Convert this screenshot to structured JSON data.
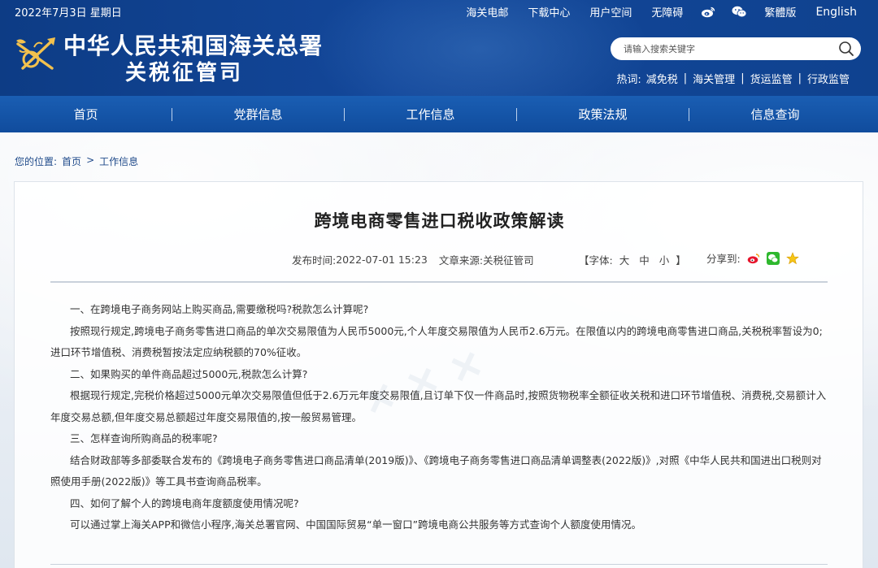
{
  "header": {
    "date": "2022年7月3日 星期日",
    "top_links": [
      "海关电邮",
      "下载中心",
      "用户空间",
      "无障碍"
    ],
    "traditional": "繁體版",
    "english": "English",
    "site_name_line1": "中华人民共和国海关总署",
    "site_name_line2": "关税征管司",
    "search_placeholder": "请输入搜索关键字",
    "hot_label": "热词:",
    "hot_words": [
      "减免税",
      "海关管理",
      "货运监管",
      "行政监管"
    ],
    "icons": [
      "weibo-icon",
      "wechat-icon",
      "search-icon",
      "customs-emblem-logo"
    ]
  },
  "nav": {
    "items": [
      "首页",
      "党群信息",
      "工作信息",
      "政策法规",
      "信息查询"
    ],
    "separator": "|"
  },
  "breadcrumb": {
    "label": "您的位置:",
    "home": "首页",
    "arrow": ">",
    "current": "工作信息"
  },
  "article": {
    "title": "跨境电商零售进口税收政策解读",
    "publish_label": "发布时间:",
    "publish_time": "2022-07-01 15:23",
    "source_label": "文章来源:",
    "source": "关税征管司",
    "font_open": "【字体:",
    "font_sizes": [
      "大",
      "中",
      "小"
    ],
    "font_close": "】",
    "share_label": "分享到:",
    "paragraphs": [
      "一、在跨境电子商务网站上购买商品,需要缴税吗?税款怎么计算呢?",
      "按照现行规定,跨境电子商务零售进口商品的单次交易限值为人民币5000元,个人年度交易限值为人民币2.6万元。在限值以内的跨境电商零售进口商品,关税税率暂设为0;进口环节增值税、消费税暂按法定应纳税额的70%征收。",
      "二、如果购买的单件商品超过5000元,税款怎么计算?",
      "根据现行规定,完税价格超过5000元单次交易限值但低于2.6万元年度交易限值,且订单下仅一件商品时,按照货物税率全额征收关税和进口环节增值税、消费税,交易额计入年度交易总额,但年度交易总额超过年度交易限值的,按一般贸易管理。",
      "三、怎样查询所购商品的税率呢?",
      "结合财政部等多部委联合发布的《跨境电子商务零售进口商品清单(2019版)》、《跨境电子商务零售进口商品清单调整表(2022版)》,对照《中华人民共和国进出口税则对照使用手册(2022版)》等工具书查询商品税率。",
      "四、如何了解个人的跨境电商年度额度使用情况呢?",
      "可以通过掌上海关APP和微信小程序,海关总署官网、中国国际贸易“单一窗口”跨境电商公共服务等方式查询个人额度使用情况。"
    ]
  },
  "colors": {
    "header_bg": "#13479a",
    "nav_bg": "#1a5eb3",
    "breadcrumb_text": "#1f4a8a"
  }
}
